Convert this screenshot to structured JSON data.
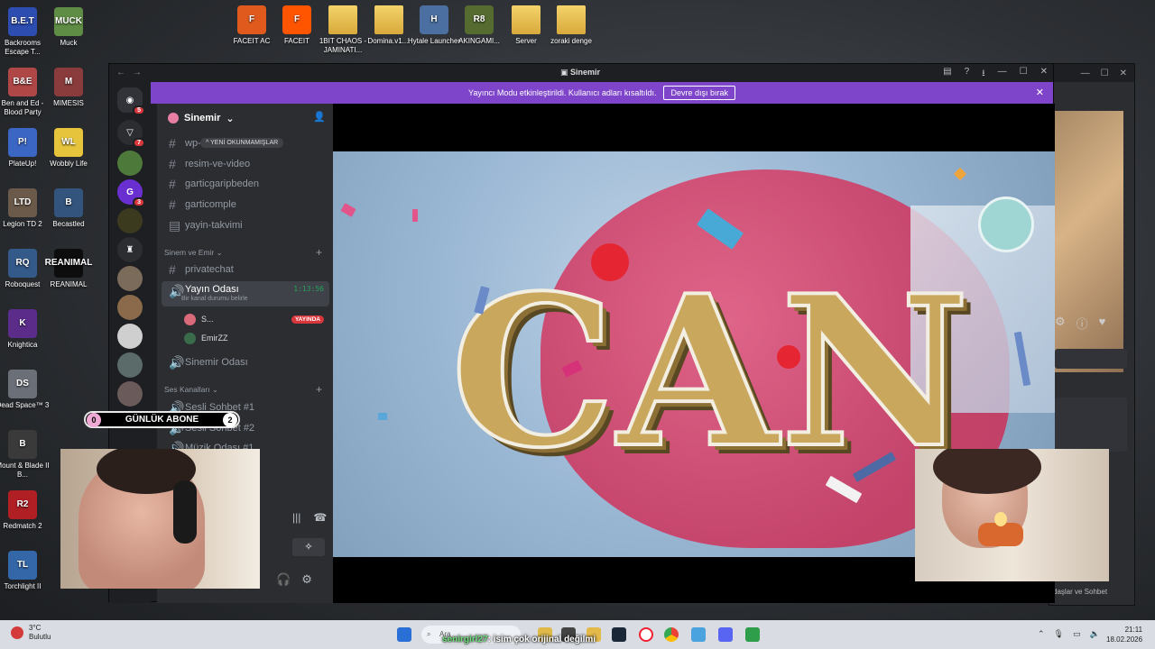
{
  "desktop_left": [
    {
      "label": "Backrooms Escape T...",
      "short": "B.E.T",
      "color": "#2d4db0"
    },
    {
      "label": "Muck",
      "short": "MUCK",
      "color": "#5f8d45"
    },
    {
      "label": "Ben and Ed - Blood Party",
      "short": "B&E",
      "color": "#b04747"
    },
    {
      "label": "MIMESIS",
      "short": "M",
      "color": "#8a3b3b"
    },
    {
      "label": "PlateUp!",
      "short": "P!",
      "color": "#3b66c4"
    },
    {
      "label": "Wobbly Life",
      "short": "WL",
      "color": "#e6c43c"
    },
    {
      "label": "Legion TD 2",
      "short": "LTD",
      "color": "#6b5a4a"
    },
    {
      "label": "Becastled",
      "short": "B",
      "color": "#33557d"
    },
    {
      "label": "Roboquest",
      "short": "RQ",
      "color": "#345a8a"
    },
    {
      "label": "REANIMAL",
      "short": "REANIMAL",
      "color": "#0d0d0d"
    },
    {
      "label": "Knightica",
      "short": "K",
      "color": "#5b2c8a"
    },
    {
      "label": "Dead Space™ 3",
      "short": "DS",
      "color": "#6b6f78"
    },
    {
      "label": "Mount & Blade II B...",
      "short": "B",
      "color": "#3a3a3a"
    },
    {
      "label": "Redmatch 2",
      "short": "R2",
      "color": "#b01f24"
    },
    {
      "label": "Torchlight II",
      "short": "TL",
      "color": "#3467a8"
    }
  ],
  "desktop_top": [
    {
      "label": "FACEIT AC",
      "short": "F",
      "color": "#e05a1e"
    },
    {
      "label": "FACEIT",
      "short": "F",
      "color": "#ff5500"
    },
    {
      "label": "1BIT CHAOS - JAMINATI...",
      "short": "",
      "color": "#e3b94a",
      "folder": true
    },
    {
      "label": "Domina.v1....",
      "short": "",
      "color": "#e3b94a",
      "folder": true
    },
    {
      "label": "Hytale Launcher",
      "short": "H",
      "color": "#4a6fa0"
    },
    {
      "label": "AKINGAMI...",
      "short": "R8",
      "color": "#556b2f"
    },
    {
      "label": "Server",
      "short": "",
      "color": "#e3b94a",
      "folder": true
    },
    {
      "label": "zoraki denge",
      "short": "",
      "color": "#e3b94a",
      "folder": true
    }
  ],
  "window": {
    "title": "Sinemir"
  },
  "banner": {
    "text": "Yayıncı Modu etkinleştirildi. Kullanıcı adları kısaltıldı.",
    "button": "Devre dışı bırak"
  },
  "server": {
    "name": "Sinemir"
  },
  "unread_pill": "YENİ OKUNMAMIŞLAR",
  "channels": {
    "text": [
      "wp-",
      "resim-ve-video",
      "garticgaripbeden",
      "garticomple",
      "yayin-takvimi"
    ],
    "category1": "Sinem ve Emir",
    "privatechat": "privatechat",
    "voice_active": {
      "name": "Yayın Odası",
      "time": "1:13:56",
      "status": "Bir kanal durumu belirle"
    },
    "members": [
      {
        "name": "S...",
        "badge": "YAYINDA"
      },
      {
        "name": "EmirZZ",
        "badge": ""
      }
    ],
    "sinemir_room": "Sinemir Odası",
    "category2": "Ses Kanalları",
    "voice": [
      "Sesli Sohbet #1",
      "Sesli Sohbet #2",
      "Müzik Odası #1"
    ]
  },
  "overlay": {
    "left_count": "0",
    "label": "GÜNLÜK ABONE",
    "right_count": "2"
  },
  "video_text": "CAN",
  "bg_window": {
    "footer": "daşlar ve Sohbet"
  },
  "weather": {
    "temp": "3°C",
    "desc": "Bulutlu"
  },
  "search_placeholder": "Ara",
  "subtitle": {
    "user": "senirgirl27",
    "text": "isim çok orijinal değilmi"
  },
  "clock": {
    "time": "21:11",
    "date": "18.02.2026"
  }
}
